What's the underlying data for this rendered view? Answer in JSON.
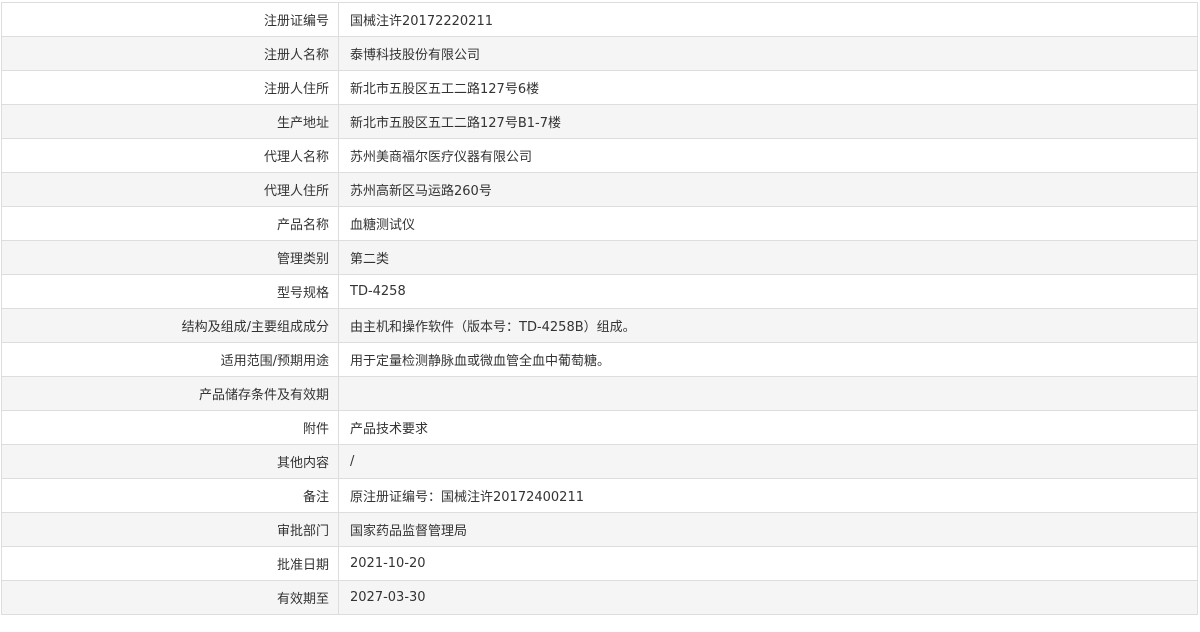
{
  "rows": [
    {
      "label": "注册证编号",
      "value": "国械注许20172220211"
    },
    {
      "label": "注册人名称",
      "value": "泰博科技股份有限公司"
    },
    {
      "label": "注册人住所",
      "value": "新北市五股区五工二路127号6楼"
    },
    {
      "label": "生产地址",
      "value": "新北市五股区五工二路127号B1-7楼"
    },
    {
      "label": "代理人名称",
      "value": "苏州美商福尔医疗仪器有限公司"
    },
    {
      "label": "代理人住所",
      "value": "苏州高新区马运路260号"
    },
    {
      "label": "产品名称",
      "value": "血糖测试仪"
    },
    {
      "label": "管理类别",
      "value": "第二类"
    },
    {
      "label": "型号规格",
      "value": "TD-4258"
    },
    {
      "label": "结构及组成/主要组成成分",
      "value": "由主机和操作软件（版本号：TD-4258B）组成。"
    },
    {
      "label": "适用范围/预期用途",
      "value": "用于定量检测静脉血或微血管全血中葡萄糖。"
    },
    {
      "label": "产品储存条件及有效期",
      "value": ""
    },
    {
      "label": "附件",
      "value": "产品技术要求"
    },
    {
      "label": "其他内容",
      "value": "/"
    },
    {
      "label": "备注",
      "value": "原注册证编号：国械注许20172400211"
    },
    {
      "label": "审批部门",
      "value": "国家药品监督管理局"
    },
    {
      "label": "批准日期",
      "value": "2021-10-20"
    },
    {
      "label": "有效期至",
      "value": "2027-03-30"
    }
  ]
}
